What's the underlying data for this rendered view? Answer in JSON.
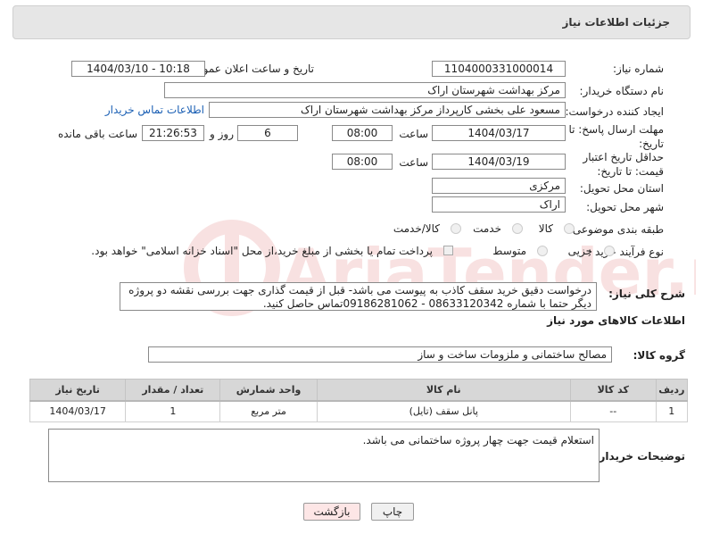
{
  "header": {
    "title": "جزئیات اطلاعات نیاز"
  },
  "form": {
    "need_number_label": "شماره نیاز:",
    "need_number": "1104000331000014",
    "announce_label": "تاریخ و ساعت اعلان عمومی:",
    "announce_value": "1404/03/10 - 10:18",
    "buyer_label": "نام دستگاه خریدار:",
    "buyer_value": "مرکز بهداشت شهرستان اراک",
    "creator_label": "ایجاد کننده درخواست:",
    "creator_value": "مسعود علی بخشی کارپرداز مرکز بهداشت شهرستان اراک",
    "contact_link": "اطلاعات تماس خریدار",
    "deadline_label": "مهلت ارسال پاسخ: تا تاریخ:",
    "deadline_date": "1404/03/17",
    "time_label": "ساعت",
    "deadline_time": "08:00",
    "days_value": "6",
    "days_label": "روز و",
    "remaining_time": "21:26:53",
    "remaining_label": "ساعت باقی مانده",
    "validity_label": "حداقل تاریخ اعتبار قیمت: تا تاریخ:",
    "validity_date": "1404/03/19",
    "validity_time": "08:00",
    "province_label": "استان محل تحویل:",
    "province_value": "مرکزی",
    "city_label": "شهر محل تحویل:",
    "city_value": "اراک",
    "category_label": "طبقه بندی موضوعی:",
    "category_options": [
      "کالا",
      "خدمت",
      "کالا/خدمت"
    ],
    "process_label": "نوع فرآیند خرید :",
    "process_options": [
      "جزیی",
      "متوسط"
    ],
    "payment_note": "پرداخت تمام یا بخشی از مبلغ خرید،از محل \"اسناد خزانه اسلامی\" خواهد بود.",
    "description_label": "شرح کلی نیاز:",
    "description_value": "درخواست دقیق خرید سقف کاذب به پیوست می باشد- قبل از قیمت گذاری جهت بررسی نقشه دو پروژه دیگر حتما با شماره 08633120342 - 09186281062تماس حاصل کنید."
  },
  "goods": {
    "section_title": "اطلاعات کالاهای مورد نیاز",
    "group_label": "گروه کالا:",
    "group_value": "مصالح ساختمانی و ملزومات ساخت و ساز",
    "columns": [
      "ردیف",
      "کد کالا",
      "نام کالا",
      "واحد شمارش",
      "تعداد / مقدار",
      "تاریخ نیاز"
    ],
    "rows": [
      {
        "row": "1",
        "code": "--",
        "name": "پانل سقف (تایل)",
        "unit": "متر مربع",
        "qty": "1",
        "date": "1404/03/17"
      }
    ]
  },
  "buyer_notes": {
    "label": "توضیحات خریدار:",
    "value": "استعلام قیمت جهت چهار پروژه ساختمانی می باشد."
  },
  "buttons": {
    "print": "چاپ",
    "back": "بازگشت"
  },
  "watermark": {
    "text": "AriaTender.neT"
  },
  "colors": {
    "link": "#1a5fb4",
    "header_bg": "#e6e6e6",
    "back_button_bg": "#fde6e6",
    "watermark": "#cc2222"
  }
}
